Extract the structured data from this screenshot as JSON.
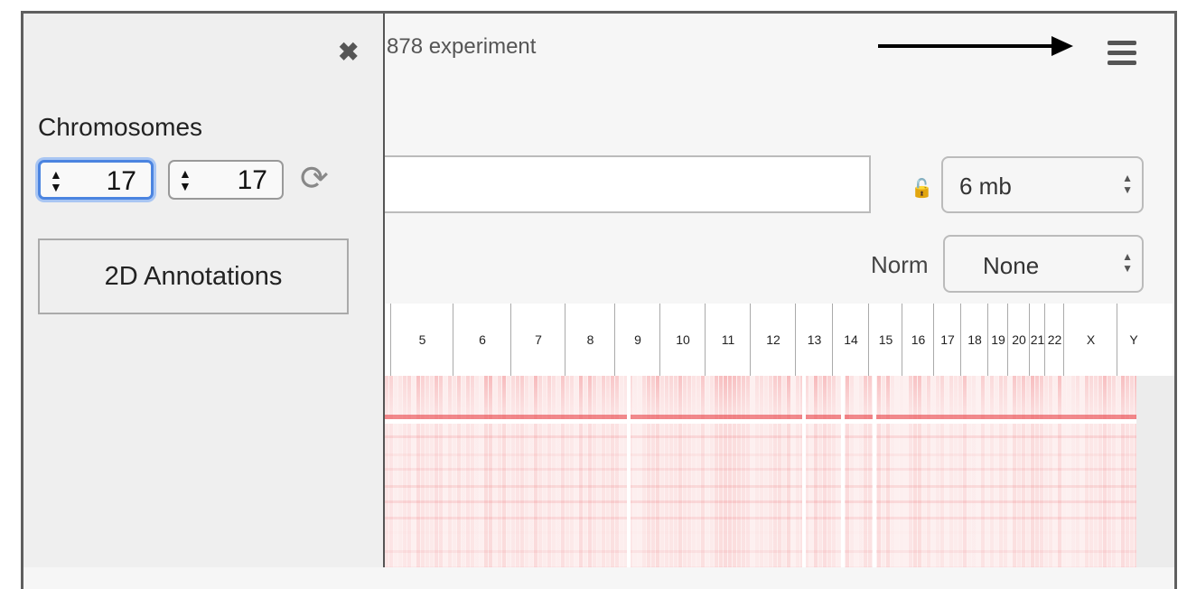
{
  "sidebar": {
    "close_icon": "close-icon",
    "chromosomes_label": "Chromosomes",
    "chrom_x": "17",
    "chrom_y": "17",
    "annotations_button": "2D Annotations"
  },
  "header": {
    "title": "878 experiment",
    "menu_icon": "hamburger-icon"
  },
  "controls": {
    "locus_value": "",
    "resolution": "6 mb",
    "norm_label": "Norm",
    "norm_value": "None"
  },
  "chromosomes": [
    "5",
    "6",
    "7",
    "8",
    "9",
    "10",
    "11",
    "12",
    "13",
    "14",
    "15",
    "16",
    "17",
    "18",
    "19",
    "20",
    "21",
    "22",
    "X",
    "Y"
  ],
  "colors": {
    "accent": "#4b84e0",
    "heatmap": "#e8343a"
  }
}
